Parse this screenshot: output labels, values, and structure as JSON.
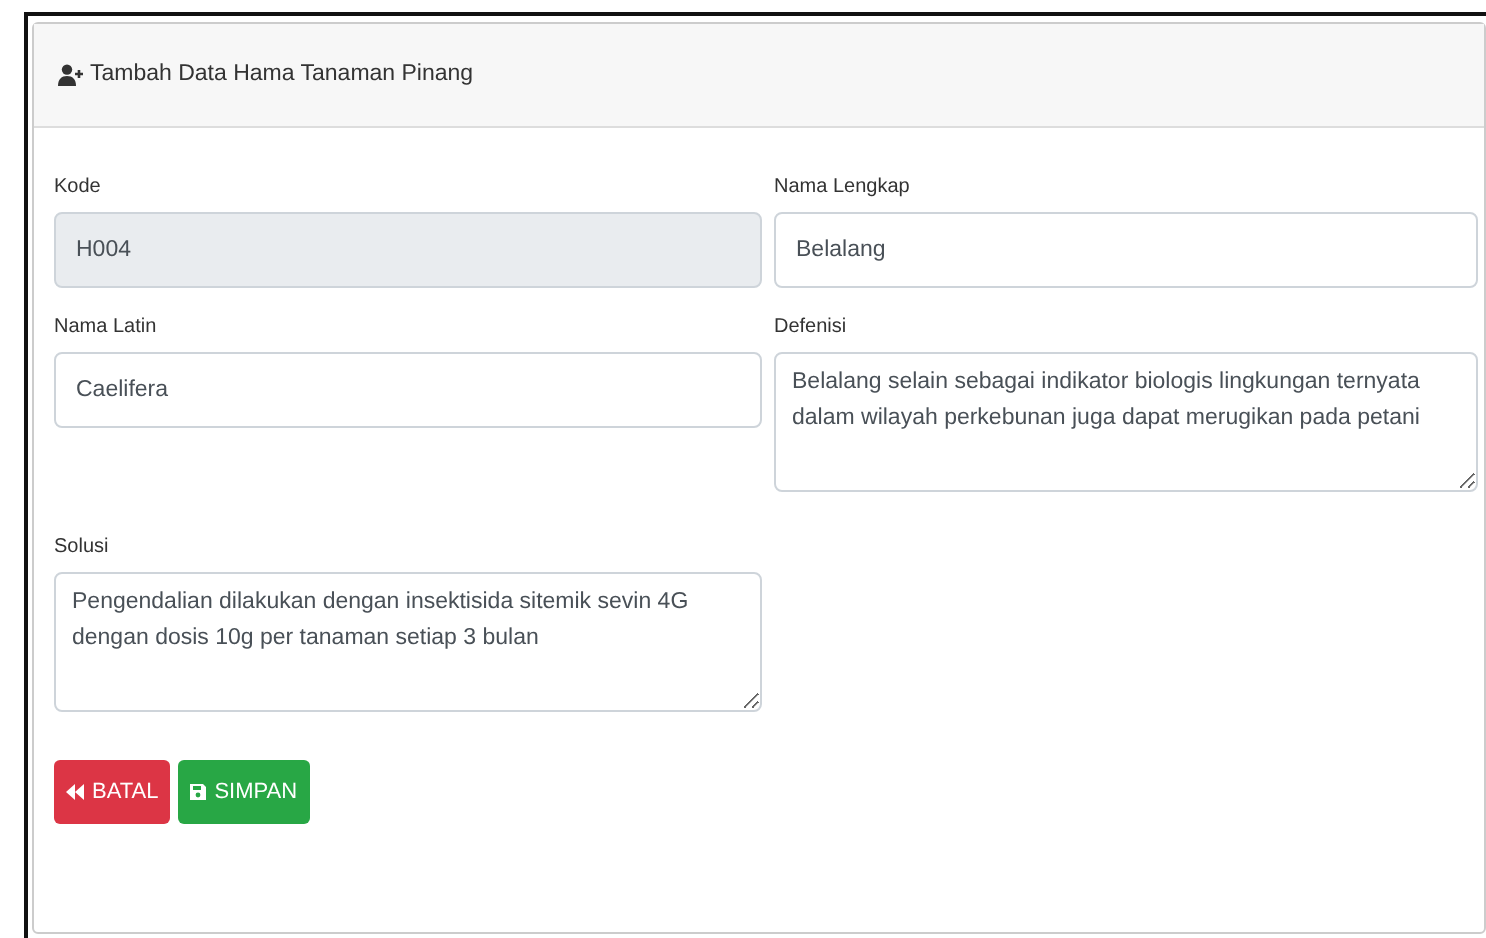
{
  "card": {
    "title": "Tambah Data Hama Tanaman Pinang"
  },
  "fields": [
    {
      "label": "Kode",
      "kind": "input",
      "value": "H004",
      "disabled": true
    },
    {
      "label": "Nama Lengkap",
      "kind": "input",
      "value": "Belalang",
      "disabled": false
    },
    {
      "label": "Nama Latin",
      "kind": "input",
      "value": "Caelifera",
      "disabled": false
    },
    {
      "label": "Defenisi",
      "kind": "textarea",
      "value": "Belalang selain sebagai indikator biologis lingkungan ternyata dalam wilayah perkebunan juga dapat merugikan pada petani",
      "disabled": false
    },
    {
      "label": "Solusi",
      "kind": "textarea",
      "value": "Pengendalian dilakukan dengan insektisida sitemik sevin 4G dengan dosis 10g per tanaman setiap 3 bulan",
      "disabled": false
    }
  ],
  "buttons": [
    {
      "label": "BATAL",
      "kind": "cancel"
    },
    {
      "label": "SIMPAN",
      "kind": "save"
    }
  ]
}
